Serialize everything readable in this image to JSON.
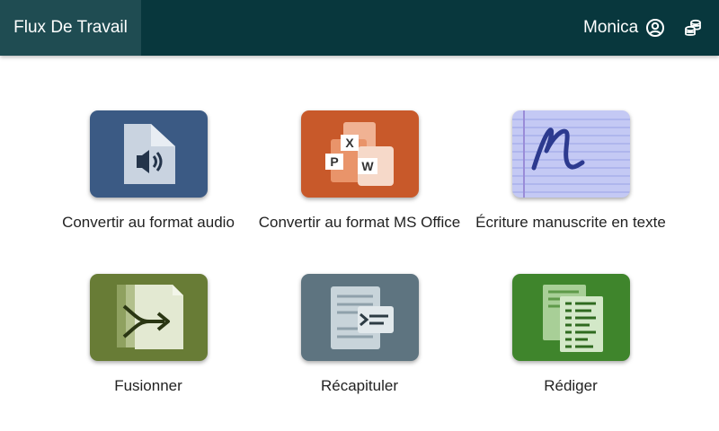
{
  "header": {
    "title": "Flux De Travail",
    "user_name": "Monica",
    "user_icon": "account-circle-icon",
    "credits_icon": "coins-icon",
    "background": "#08373d"
  },
  "workflows": [
    {
      "label": "Convertir au format audio",
      "icon": "audio-file-icon",
      "color": "#3b5a84"
    },
    {
      "label": "Convertir au format MS Office",
      "icon": "ms-office-icon",
      "color": "#c8592a"
    },
    {
      "label": "Écriture manuscrite en texte",
      "icon": "handwriting-icon",
      "color": "#c4c9f4"
    },
    {
      "label": "Fusionner",
      "icon": "merge-icon",
      "color": "#687c36"
    },
    {
      "label": "Récapituler",
      "icon": "summarize-icon",
      "color": "#5e7480"
    },
    {
      "label": "Rédiger",
      "icon": "draft-icon",
      "color": "#3f852c"
    }
  ],
  "ms_office_letters": [
    "X",
    "P",
    "W"
  ]
}
